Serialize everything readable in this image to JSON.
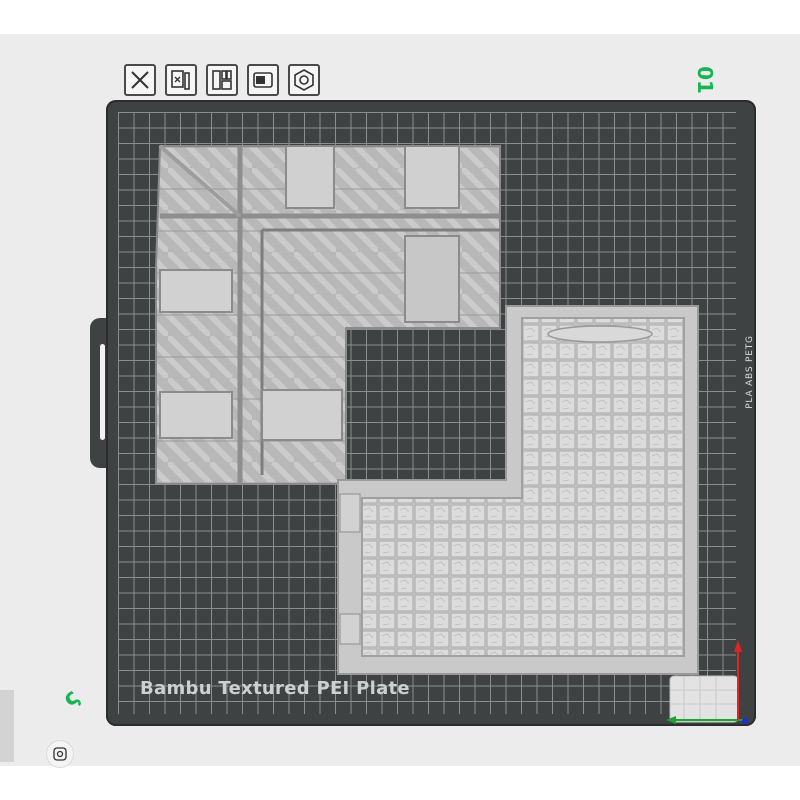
{
  "plate": {
    "number": "01",
    "name": "Bambu Textured PEI Plate",
    "edge_label": "PLA ABS PETG",
    "left_marker": "ς"
  },
  "toolbar": {
    "buttons": [
      {
        "name": "close-plate-button",
        "icon": "x-icon"
      },
      {
        "name": "auto-orient-button",
        "icon": "orient-icon"
      },
      {
        "name": "arrange-button",
        "icon": "arrange-icon"
      },
      {
        "name": "plate-settings-button",
        "icon": "plate-icon"
      },
      {
        "name": "lock-button",
        "icon": "hex-nut-icon"
      }
    ]
  },
  "colors": {
    "accent": "#17b454",
    "bed": "#3f4242",
    "grid": "#8b8e8e",
    "axis_x": "#1aa531",
    "axis_y": "#e02424",
    "axis_z": "#1a2fd6"
  }
}
